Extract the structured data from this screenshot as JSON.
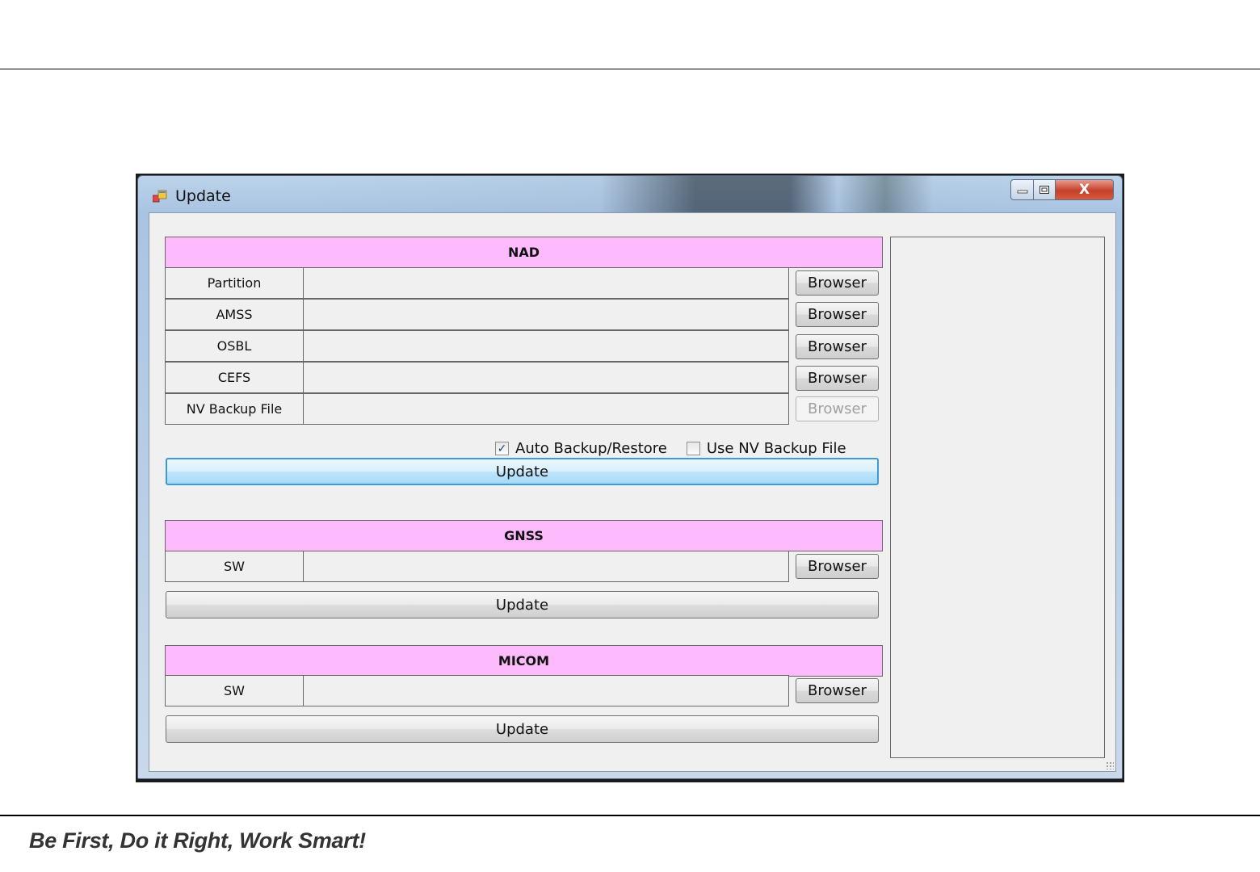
{
  "window": {
    "title": "Update",
    "controls": {
      "minimize": "—",
      "maximize": "▢",
      "close": "X"
    }
  },
  "nad": {
    "header": "NAD",
    "rows": [
      {
        "label": "Partition",
        "value": "",
        "browse": "Browser"
      },
      {
        "label": "AMSS",
        "value": "",
        "browse": "Browser"
      },
      {
        "label": "OSBL",
        "value": "",
        "browse": "Browser"
      },
      {
        "label": "CEFS",
        "value": "",
        "browse": "Browser"
      },
      {
        "label": "NV Backup File",
        "value": "",
        "browse": "Browser"
      }
    ],
    "auto_backup": {
      "label": "Auto Backup/Restore",
      "checked": true
    },
    "use_nv_backup": {
      "label": "Use NV Backup File",
      "checked": false
    },
    "update": "Update"
  },
  "gnss": {
    "header": "GNSS",
    "rows": [
      {
        "label": "SW",
        "value": "",
        "browse": "Browser"
      }
    ],
    "update": "Update"
  },
  "micom": {
    "header": "MICOM",
    "rows": [
      {
        "label": "SW",
        "value": "",
        "browse": "Browser"
      }
    ],
    "update": "Update"
  },
  "footer": {
    "slogan": "Be First, Do it Right, Work Smart!"
  },
  "colors": {
    "section_header": "#fdbbfd",
    "focus_border": "#3c9ad6",
    "close_button": "#c3412a"
  }
}
